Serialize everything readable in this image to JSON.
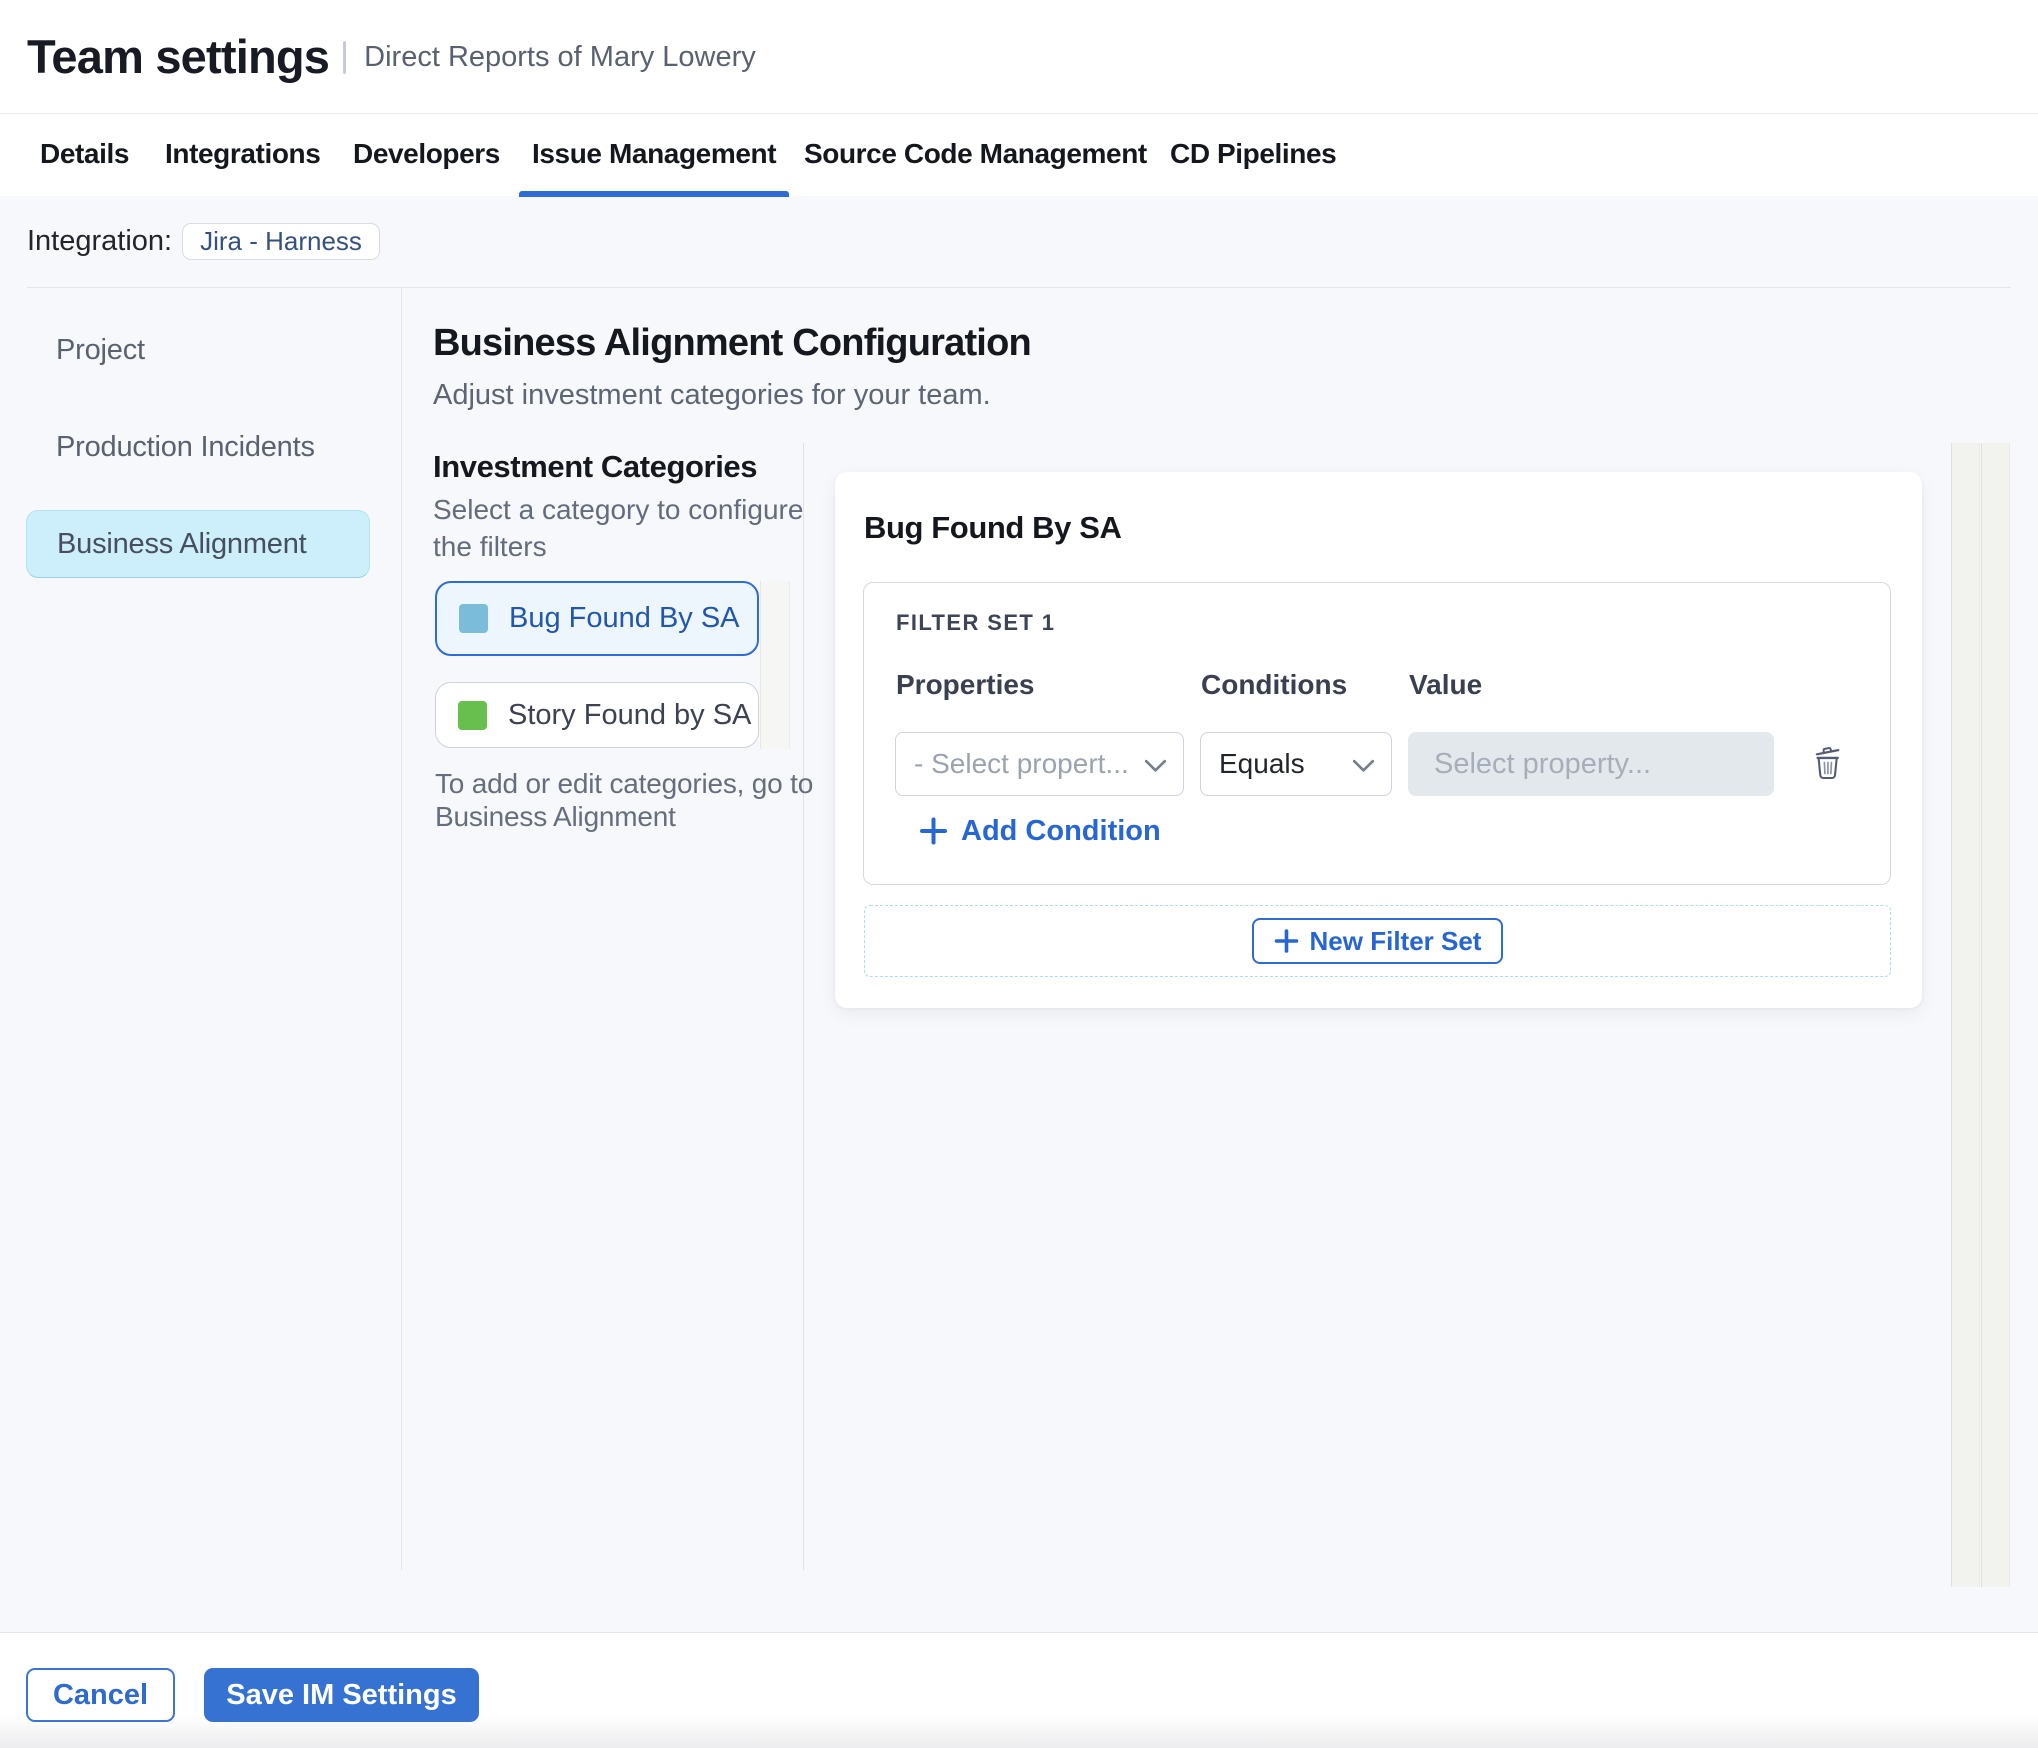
{
  "header": {
    "title": "Team settings",
    "subtitle": "Direct Reports of Mary Lowery"
  },
  "tabs": {
    "active_index": 3,
    "items": [
      {
        "label": "Details"
      },
      {
        "label": "Integrations"
      },
      {
        "label": "Developers"
      },
      {
        "label": "Issue Management"
      },
      {
        "label": "Source Code Management"
      },
      {
        "label": "CD Pipelines"
      }
    ]
  },
  "integration": {
    "label": "Integration:",
    "value": "Jira - Harness"
  },
  "sidebar": {
    "active_index": 2,
    "items": [
      {
        "label": "Project"
      },
      {
        "label": "Production Incidents"
      },
      {
        "label": "Business Alignment"
      }
    ]
  },
  "main": {
    "title": "Business Alignment Configuration",
    "subtitle": "Adjust investment categories for your team.",
    "categories": {
      "title": "Investment Categories",
      "description": "Select a category to configure the filters",
      "selected_index": 0,
      "items": [
        {
          "label": "Bug Found By SA",
          "color": "#7bbcdb"
        },
        {
          "label": "Story Found by SA",
          "color": "#69bf4d"
        }
      ],
      "note_line1": "To add or edit categories, go to",
      "note_line2": "Business Alignment"
    },
    "panel": {
      "title": "Bug Found By SA",
      "filter_set": {
        "title": "FILTER SET 1",
        "properties_header": "Properties",
        "conditions_header": "Conditions",
        "value_header": "Value",
        "property_placeholder": "- Select propert...",
        "condition_value": "Equals",
        "value_placeholder": "Select property...",
        "add_condition_label": "Add Condition"
      },
      "new_filter_set_label": "New Filter Set"
    }
  },
  "footer": {
    "cancel_label": "Cancel",
    "save_label": "Save IM Settings"
  },
  "colors": {
    "accent_blue": "#2e6bd2",
    "selected_category_background": "#edf6fc",
    "sidebar_active_background": "#cdeefb",
    "bug_swatch": "#7bbcdb",
    "story_swatch": "#69bf4d"
  }
}
